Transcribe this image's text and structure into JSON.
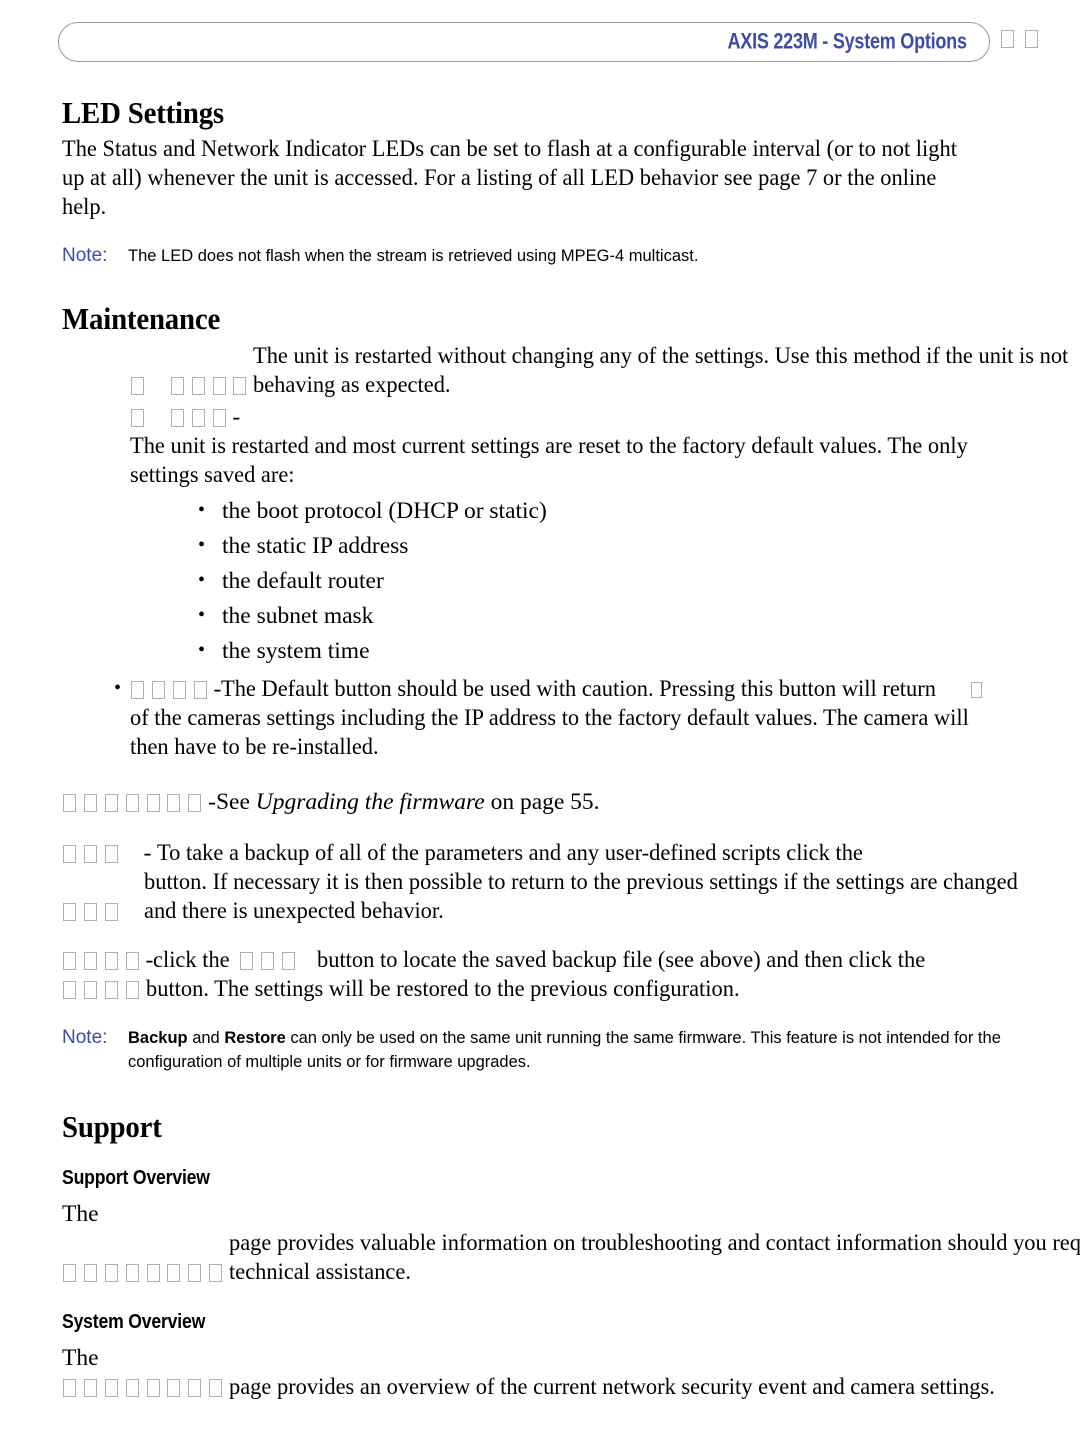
{
  "header": {
    "title": "AXIS 223M - System Options",
    "title_color": "#3b4da8",
    "trailing_glyphs": 2
  },
  "sections": [
    {
      "id": "led-settings",
      "heading": "LED Settings",
      "paragraph": "The Status and Network Indicator LEDs can be set to flash at a configurable interval (or to not light up at all) whenever the unit is accessed. For a listing of all LED behavior see page 7 or the online help.",
      "note": {
        "label": "Note:",
        "text": "The LED does not flash when the stream is retrieved using MPEG-4 multicast."
      }
    },
    {
      "id": "maintenance",
      "heading": "Maintenance",
      "bullets": [
        {
          "glyph_boxes_lead": 1,
          "glyph_boxes": 4,
          "separator": "",
          "text": "The unit is restarted without changing any of the settings. Use this method if the unit is not behaving as expected."
        },
        {
          "glyph_boxes_lead": 1,
          "glyph_boxes": 3,
          "separator": "-",
          "text": "The unit is restarted and most current settings are reset to the factory default values. The only settings saved are:",
          "sub_items": [
            "the boot protocol (DHCP or static)",
            "the static IP address",
            "the default router",
            "the subnet mask",
            "the system time"
          ]
        },
        {
          "bullet_dot": true,
          "glyph_boxes": 4,
          "separator": "-",
          "text_part1": "The Default button should be used with caution. Pressing this button will return",
          "inline_boxes": 1,
          "text_part2": "of the cameras settings including the IP address to the factory default values. The camera will then have to be re-installed."
        }
      ],
      "paragraphs": [
        {
          "id": "upgrade-firmware",
          "glyph_boxes": 7,
          "separator": "-",
          "text_before": "See ",
          "italic_title": "Upgrading the firmware",
          "text_after": " on page 55."
        },
        {
          "id": "backup",
          "glyph_boxes_line1": 3,
          "separator": "-",
          "text1": "To take a backup of all of the parameters and any user-defined scripts click the",
          "glyph_boxes_line2": 3,
          "text2": "button. If necessary it is then possible to return to the previous settings if the settings are changed and there is unexpected behavior."
        },
        {
          "id": "restore",
          "glyph_boxes_lead": 4,
          "separator": "-",
          "text1": "click the",
          "glyph_boxes_mid": 3,
          "text2": "button to locate the saved backup file (see above) and then click the",
          "glyph_boxes_end": 4,
          "text3": "button. The settings will be restored to the previous configuration."
        }
      ],
      "note": {
        "label": "Note:",
        "bold1": "Backup",
        "mid": " and ",
        "bold2": "Restore",
        "text": " can only be used on the same unit running the same firmware. This feature is not intended for the configuration of multiple units or for firmware upgrades."
      }
    },
    {
      "id": "support",
      "heading": "Support",
      "subsections": [
        {
          "id": "support-overview",
          "heading": "Support Overview",
          "text_before": "The",
          "glyph_boxes": 8,
          "text_after": "page provides valuable information on troubleshooting and contact information should you require technical assistance."
        },
        {
          "id": "system-overview",
          "heading": "System Overview",
          "text_before": "The",
          "glyph_boxes": 8,
          "text_after": "page provides an overview of the current network security event and camera settings."
        }
      ]
    }
  ]
}
